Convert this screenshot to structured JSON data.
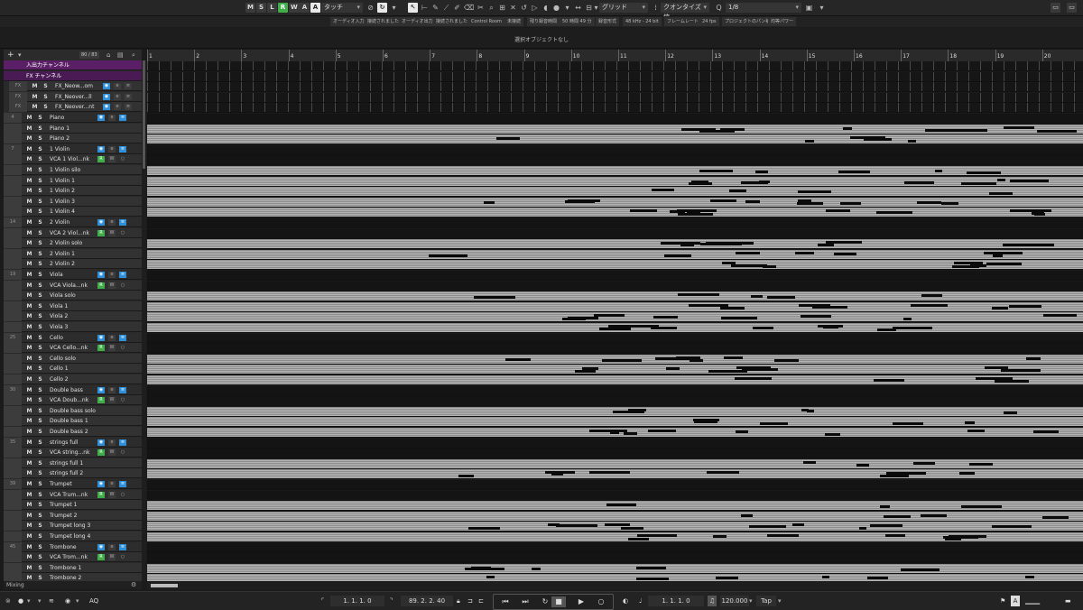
{
  "toolbar": {
    "buttons": [
      "M",
      "S",
      "L",
      "R",
      "W",
      "A"
    ],
    "automation_mode": "タッチ",
    "grid_type": "グリッド",
    "quantize_label": "クオンタイズ値",
    "quantize_value": "1/8"
  },
  "status_bar": {
    "items": [
      "オーディオ入力",
      "接続されました",
      "オーディオ出力",
      "接続されました",
      "Control Room",
      "未接続",
      "残り録音時間",
      "50 時間 49 分",
      "録音形式",
      "48 kHz - 24 bit",
      "フレームレート",
      "24 fps",
      "プロジェクトのパン補正",
      "均等パワー"
    ]
  },
  "info_line": "選択オブジェクトなし",
  "track_header": {
    "count": "80 / 83"
  },
  "channels": {
    "input": "入出力チャンネル",
    "fx": "FX チャンネル"
  },
  "fx_tracks": [
    {
      "num": "FX",
      "name": "FX_Neow...om"
    },
    {
      "num": "FX",
      "name": "FX_Neover...ll"
    },
    {
      "num": "FX",
      "name": "FX_Neover...nt"
    }
  ],
  "tracks": [
    {
      "num": "4",
      "name": "Piano",
      "kind": "folder"
    },
    {
      "num": "",
      "name": "Piano 1",
      "kind": "inst"
    },
    {
      "num": "",
      "name": "Piano 2",
      "kind": "inst"
    },
    {
      "num": "7",
      "name": "1 Violin",
      "kind": "folder"
    },
    {
      "num": "",
      "name": "VCA 1 Viol...nk",
      "kind": "vca"
    },
    {
      "num": "",
      "name": "1 Violin silo",
      "kind": "inst"
    },
    {
      "num": "",
      "name": "1 Violin 1",
      "kind": "inst"
    },
    {
      "num": "",
      "name": "1 Violin 2",
      "kind": "inst"
    },
    {
      "num": "",
      "name": "1 Violin 3",
      "kind": "inst"
    },
    {
      "num": "",
      "name": "1 Violin 4",
      "kind": "inst"
    },
    {
      "num": "14",
      "name": "2 Violin",
      "kind": "folder"
    },
    {
      "num": "",
      "name": "VCA 2 Viol...nk",
      "kind": "vca"
    },
    {
      "num": "",
      "name": "2 Violin solo",
      "kind": "inst"
    },
    {
      "num": "",
      "name": "2 Violin 1",
      "kind": "inst"
    },
    {
      "num": "",
      "name": "2 Violin 2",
      "kind": "inst"
    },
    {
      "num": "19",
      "name": "Viola",
      "kind": "folder"
    },
    {
      "num": "",
      "name": "VCA Viola...nk",
      "kind": "vca"
    },
    {
      "num": "",
      "name": "Viola solo",
      "kind": "inst"
    },
    {
      "num": "",
      "name": "Viola 1",
      "kind": "inst"
    },
    {
      "num": "",
      "name": "Viola 2",
      "kind": "inst"
    },
    {
      "num": "",
      "name": "Viola 3",
      "kind": "inst"
    },
    {
      "num": "25",
      "name": "Cello",
      "kind": "folder"
    },
    {
      "num": "",
      "name": "VCA Cello...nk",
      "kind": "vca"
    },
    {
      "num": "",
      "name": "Cello solo",
      "kind": "inst"
    },
    {
      "num": "",
      "name": "Cello 1",
      "kind": "inst"
    },
    {
      "num": "",
      "name": "Cello 2",
      "kind": "inst"
    },
    {
      "num": "30",
      "name": "Double bass",
      "kind": "folder"
    },
    {
      "num": "",
      "name": "VCA Doub...nk",
      "kind": "vca"
    },
    {
      "num": "",
      "name": "Double bass solo",
      "kind": "inst"
    },
    {
      "num": "",
      "name": "Double bass 1",
      "kind": "inst"
    },
    {
      "num": "",
      "name": "Double bass 2",
      "kind": "inst"
    },
    {
      "num": "35",
      "name": "strings full",
      "kind": "folder"
    },
    {
      "num": "",
      "name": "VCA string...nk",
      "kind": "vca"
    },
    {
      "num": "",
      "name": "strings full 1",
      "kind": "inst"
    },
    {
      "num": "",
      "name": "strings full 2",
      "kind": "inst"
    },
    {
      "num": "39",
      "name": "Trumpet",
      "kind": "folder"
    },
    {
      "num": "",
      "name": "VCA Trum...nk",
      "kind": "vca"
    },
    {
      "num": "",
      "name": "Trumpet 1",
      "kind": "inst"
    },
    {
      "num": "",
      "name": "Trumpet 2",
      "kind": "inst"
    },
    {
      "num": "",
      "name": "Trumpet long 3",
      "kind": "inst"
    },
    {
      "num": "",
      "name": "Trumpet long 4",
      "kind": "inst"
    },
    {
      "num": "45",
      "name": "Trombone",
      "kind": "folder"
    },
    {
      "num": "",
      "name": "VCA Trom...nk",
      "kind": "vca"
    },
    {
      "num": "",
      "name": "Trombone 1",
      "kind": "inst"
    },
    {
      "num": "",
      "name": "Trombone 2",
      "kind": "inst"
    }
  ],
  "vca_buttons": {
    "r": "R",
    "w": "W"
  },
  "ruler_bars": [
    "1",
    "2",
    "3",
    "4",
    "5",
    "6",
    "7",
    "8",
    "9",
    "10",
    "11",
    "12",
    "13",
    "14",
    "15",
    "16",
    "17",
    "18",
    "19",
    "20"
  ],
  "mixing_label": "Mixing",
  "transport": {
    "left_locator": "1. 1. 1. 0",
    "right_locator": "89. 2. 2. 40",
    "position": "1. 1. 1. 0",
    "tempo": "120.000",
    "tap_label": "Tap",
    "aq_label": "AQ"
  }
}
